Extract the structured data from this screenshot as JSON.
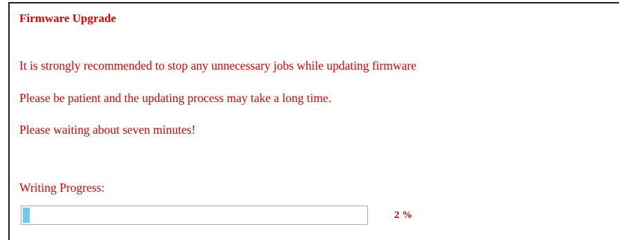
{
  "firmware_upgrade": {
    "title": "Firmware Upgrade",
    "messages": [
      "It is strongly recommended to stop any unnecessary jobs while updating firmware",
      "Please be patient and the updating process may take a long time.",
      "Please waiting about seven minutes!"
    ],
    "progress": {
      "label": "Writing Progress:",
      "percent_text": "2 %",
      "fraction": 0.02,
      "fill_color": "#6fc8f2"
    },
    "text_color": "#e60000"
  }
}
